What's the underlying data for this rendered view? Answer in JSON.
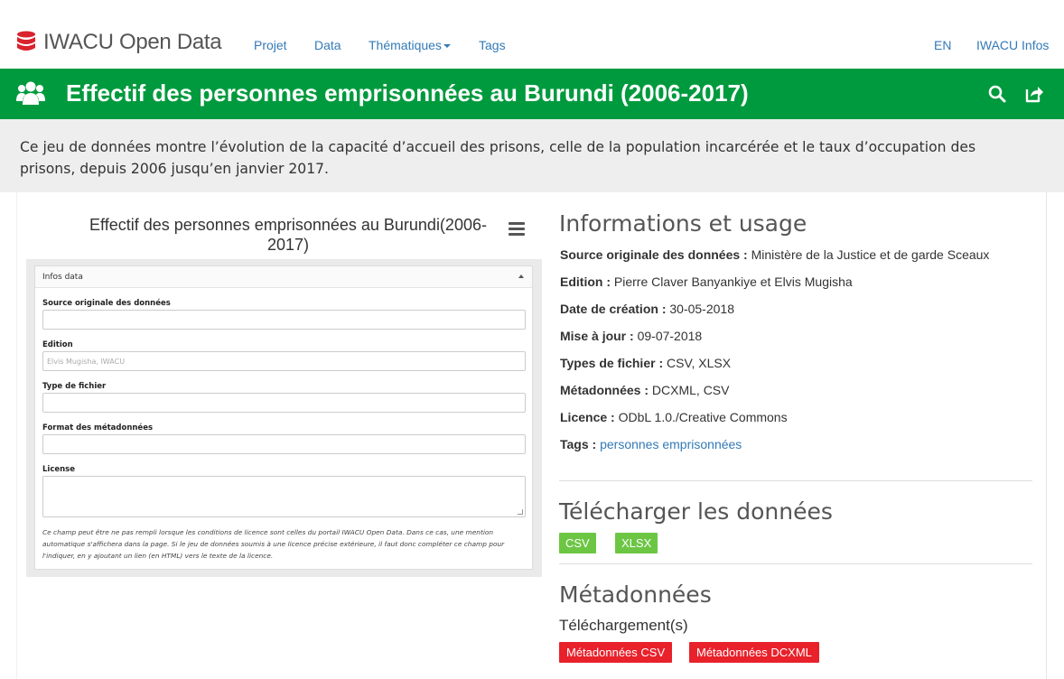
{
  "navbar": {
    "brand": "IWACU Open Data",
    "links": [
      "Projet",
      "Data",
      "Thématiques",
      "Tags"
    ],
    "lang": "EN",
    "infos": "IWACU Infos"
  },
  "header": {
    "title": "Effectif des personnes emprisonnées au Burundi (2006-2017)"
  },
  "description": "Ce jeu de données montre l’évolution de la capacité d’accueil des prisons, celle de la population incarcérée et le taux d’occupation des prisons, depuis 2006 jusqu’en janvier 2017.",
  "chart": {
    "title": "Effectif des personnes emprisonnées au Burundi(2006-2017)"
  },
  "embedded_form": {
    "panel_title": "Infos data",
    "fields": [
      {
        "label": "Source originale des données",
        "value": ""
      },
      {
        "label": "Edition",
        "value": "Elvis Mugisha, IWACU"
      },
      {
        "label": "Type de fichier",
        "value": ""
      },
      {
        "label": "Format des métadonnées",
        "value": ""
      },
      {
        "label": "License",
        "value": ""
      }
    ],
    "help_text": "Ce champ peut être ne pas rempli lorsque les conditions de licence sont celles du portail IWACU Open Data. Dans ce cas, une mention automatique s'affichera dans la page. Si le jeu de données soumis à une licence précise extérieure, il faut donc compléter ce champ pour l'indiquer, en y ajoutant un lien (en HTML) vers le texte de la licence."
  },
  "info": {
    "heading": "Informations et usage",
    "rows": [
      {
        "label": "Source originale des données :",
        "value": "Ministère de la Justice et de garde Sceaux"
      },
      {
        "label": "Edition :",
        "value": "Pierre Claver Banyankiye et Elvis Mugisha"
      },
      {
        "label": "Date de création :",
        "value": "30-05-2018"
      },
      {
        "label": "Mise à jour :",
        "value": "09-07-2018"
      },
      {
        "label": "Types de fichier :",
        "value": "CSV, XLSX"
      },
      {
        "label": "Métadonnées :",
        "value": "DCXML, CSV"
      },
      {
        "label": "Licence :",
        "value": "ODbL 1.0./Creative Commons"
      },
      {
        "label": "Tags :",
        "value": "personnes emprisonnées"
      }
    ]
  },
  "download": {
    "heading": "Télécharger les données",
    "buttons": [
      "CSV",
      "XLSX"
    ]
  },
  "metadata": {
    "heading": "Métadonnées",
    "subheading": "Téléchargement(s)",
    "buttons": [
      "Métadonnées CSV",
      "Métadonnées DCXML"
    ]
  },
  "colors": {
    "header_green": "#009a3e",
    "link_blue": "#337ab7",
    "download_green": "#6cc644",
    "metadata_red": "#e8212b",
    "brand_red": "#d9232d"
  }
}
